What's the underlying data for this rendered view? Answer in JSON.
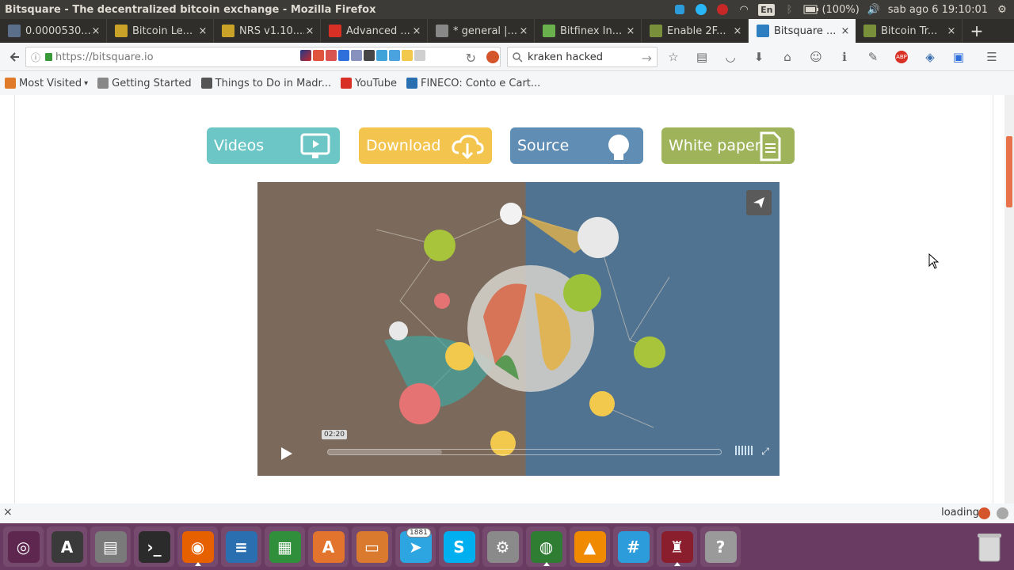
{
  "window": {
    "title": "Bitsquare - The decentralized bitcoin exchange - Mozilla Firefox"
  },
  "panel": {
    "lang": "En",
    "battery": "(100%)",
    "clock": "sab ago  6 19:10:01"
  },
  "tabs": [
    {
      "label": "0.0000530...",
      "favicon": "x-icon",
      "color": "#5b6f8a"
    },
    {
      "label": "Bitcoin Le...",
      "favicon": "coin-icon",
      "color": "#c9a227"
    },
    {
      "label": "NRS v1.10....",
      "favicon": "coin-icon",
      "color": "#c9a227"
    },
    {
      "label": "Advanced ...",
      "favicon": "youtube-icon",
      "color": "#d93025"
    },
    {
      "label": "* general |...",
      "favicon": "hash-icon",
      "color": "#888888"
    },
    {
      "label": "Bitfinex In...",
      "favicon": "leaf-icon",
      "color": "#6ab04c"
    },
    {
      "label": "Enable 2F...",
      "favicon": "bolt-icon",
      "color": "#7a8f3a"
    },
    {
      "label": "Bitsquare ...",
      "favicon": "bitsquare-icon",
      "color": "#2d7fc1",
      "active": true
    },
    {
      "label": "Bitcoin Tr...",
      "favicon": "bolt-icon",
      "color": "#7a8f3a"
    }
  ],
  "nav": {
    "url": "https://bitsquare.io",
    "search_value": "kraken hacked"
  },
  "bookmarks": [
    {
      "label": "Most Visited",
      "icon": "folder-icon",
      "color": "#e07b2a"
    },
    {
      "label": "Getting Started",
      "icon": "firefox-icon",
      "color": "#888888"
    },
    {
      "label": "Things to Do in Madr...",
      "icon": "page-icon",
      "color": "#555555"
    },
    {
      "label": "YouTube",
      "icon": "youtube-icon",
      "color": "#d93025"
    },
    {
      "label": "FINECO: Conto e Cart...",
      "icon": "fineco-icon",
      "color": "#2a6fb0"
    }
  ],
  "page": {
    "buttons": [
      {
        "label": "Videos",
        "icon": "monitor-play-icon",
        "color": "#6cc6c6"
      },
      {
        "label": "Download",
        "icon": "cloud-download-icon",
        "color": "#f3c44e"
      },
      {
        "label": "Source",
        "icon": "github-icon",
        "color": "#5f8db3"
      },
      {
        "label": "White paper",
        "icon": "document-icon",
        "color": "#9fb45a"
      }
    ],
    "video": {
      "time": "02:20",
      "progress": 0.29
    }
  },
  "status": {
    "text": "loading"
  },
  "launcher": {
    "apps": [
      {
        "name": "dash-icon",
        "color": "#5e2750",
        "glyph": "◎"
      },
      {
        "name": "software-updater-icon",
        "color": "#3a3a3a",
        "glyph": "A"
      },
      {
        "name": "files-icon",
        "color": "#7a7a7a",
        "glyph": "▤"
      },
      {
        "name": "terminal-icon",
        "color": "#2b2b2b",
        "glyph": "›_"
      },
      {
        "name": "firefox-icon",
        "color": "#e66000",
        "glyph": "◉",
        "running": true
      },
      {
        "name": "writer-icon",
        "color": "#2a6fb0",
        "glyph": "≡"
      },
      {
        "name": "calc-icon",
        "color": "#2f8f3a",
        "glyph": "▦"
      },
      {
        "name": "software-center-icon",
        "color": "#e2742e",
        "glyph": "A"
      },
      {
        "name": "impress-icon",
        "color": "#d97a2e",
        "glyph": "▭"
      },
      {
        "name": "telegram-icon",
        "color": "#2ca5e0",
        "glyph": "➤",
        "badge": "1881"
      },
      {
        "name": "skype-icon",
        "color": "#00aff0",
        "glyph": "S"
      },
      {
        "name": "system-settings-icon",
        "color": "#8a8a8a",
        "glyph": "⚙"
      },
      {
        "name": "globe-app-icon",
        "color": "#2e7d32",
        "glyph": "◍",
        "running": true
      },
      {
        "name": "vlc-icon",
        "color": "#f08a00",
        "glyph": "▲"
      },
      {
        "name": "slack-icon",
        "color": "#2d9cdb",
        "glyph": "#"
      },
      {
        "name": "wine-icon",
        "color": "#8b1e2d",
        "glyph": "♜",
        "running": true
      },
      {
        "name": "help-icon",
        "color": "#9a9a9a",
        "glyph": "?"
      }
    ]
  }
}
